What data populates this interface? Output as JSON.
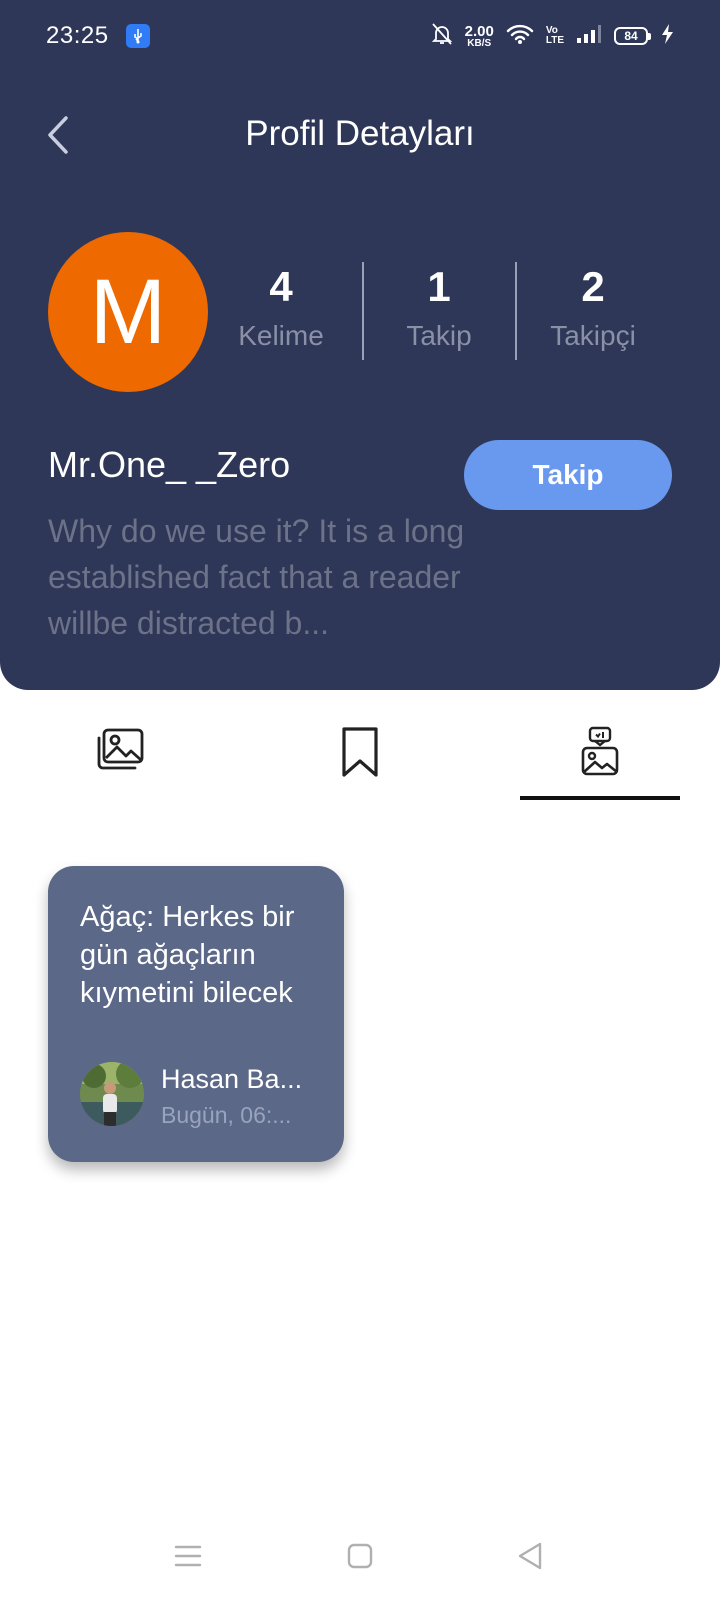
{
  "status_bar": {
    "time": "23:25",
    "net_speed_value": "2.00",
    "net_speed_unit": "KB/S",
    "volte_top": "Vo",
    "volte_bottom": "LTE",
    "battery": "84"
  },
  "header": {
    "title": "Profil Detayları"
  },
  "profile": {
    "avatar_letter": "M",
    "avatar_color": "#ee6a00",
    "stats": [
      {
        "value": "4",
        "label": "Kelime"
      },
      {
        "value": "1",
        "label": "Takip"
      },
      {
        "value": "2",
        "label": "Takipçi"
      }
    ],
    "username": "Mr.One_ _Zero",
    "follow_label": "Takip",
    "bio": "Why do we use it? It is a long established fact that a reader willbe distracted b..."
  },
  "tabs": [
    {
      "icon": "images-icon",
      "active": false
    },
    {
      "icon": "bookmark-icon",
      "active": false
    },
    {
      "icon": "liked-images-icon",
      "active": true
    }
  ],
  "posts": [
    {
      "title": "Ağaç: Herkes bir gün ağaçların kıymetini bilecek",
      "author": "Hasan Ba...",
      "time": "Bugün, 06:..."
    }
  ],
  "colors": {
    "header_bg": "#2e3758",
    "accent": "#6899ee",
    "card_bg": "#5b6887"
  }
}
